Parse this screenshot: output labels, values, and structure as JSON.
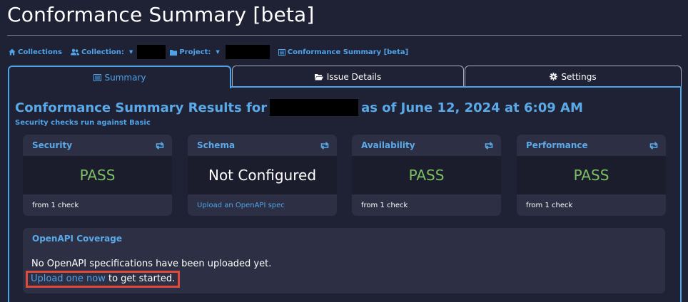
{
  "page": {
    "title": "Conformance Summary [beta]"
  },
  "breadcrumb": {
    "collections": "Collections",
    "collection": "Collection:",
    "project": "Project:",
    "current": "Conformance Summary [beta]"
  },
  "tabs": [
    {
      "label": "Summary",
      "icon": "list-icon",
      "active": true
    },
    {
      "label": "Issue Details",
      "icon": "folder-open-icon",
      "active": false
    },
    {
      "label": "Settings",
      "icon": "gear-icon",
      "active": false
    }
  ],
  "summary": {
    "heading_prefix": "Conformance Summary Results for",
    "heading_suffix": "as of June 12, 2024 at 6:09 AM",
    "subline": "Security checks run against Basic"
  },
  "cards": [
    {
      "title": "Security",
      "status": "PASS",
      "footer": "from 1 check"
    },
    {
      "title": "Schema",
      "status": "Not Configured",
      "footer": "Upload an OpenAPI spec"
    },
    {
      "title": "Availability",
      "status": "PASS",
      "footer": "from 1 check"
    },
    {
      "title": "Performance",
      "status": "PASS",
      "footer": "from 1 check"
    }
  ],
  "coverage": {
    "title": "OpenAPI Coverage",
    "message": "No OpenAPI specifications have been uploaded yet.",
    "link": "Upload one now",
    "suffix": " to get started."
  },
  "colors": {
    "accent": "#4fa3e8",
    "pass": "#7cc066",
    "highlight": "#e04a3a",
    "background": "#1f2134"
  }
}
